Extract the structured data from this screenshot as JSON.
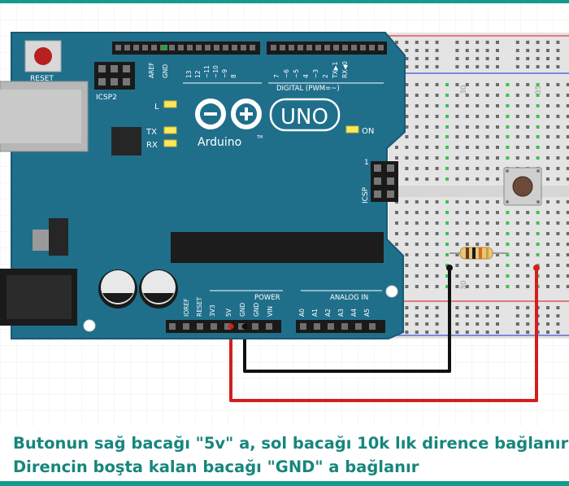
{
  "board": {
    "reset_label": "RESET",
    "icsp2_label": "ICSP2",
    "icsp_label": "ICSP",
    "icsp_pin1": "1",
    "aref": "AREF",
    "gnd": "GND",
    "pins_digital": [
      "13",
      "12",
      "~11",
      "~10",
      "~9",
      "8",
      "7",
      "~6",
      "~5",
      "4",
      "~3",
      "2",
      "TX▶1",
      "RX◀0"
    ],
    "digital_label": "DIGITAL (PWM=~)",
    "led_l": "L",
    "led_tx": "TX",
    "led_rx": "RX",
    "on_label": "ON",
    "brand": "Arduino",
    "tm": "TM",
    "model": "UNO",
    "power_label": "POWER",
    "power_pins": [
      "IOREF",
      "RESET",
      "3V3",
      "5V",
      "GND",
      "GND",
      "VIN"
    ],
    "analog_label": "ANALOG IN",
    "analog_pins": [
      "A0",
      "A1",
      "A2",
      "A3",
      "A4",
      "A5"
    ]
  },
  "breadboard": {
    "col_label_top_30": "30",
    "col_label_top_35": "35",
    "col_label_bottom_30": "30"
  },
  "captions": {
    "line1": "Butonun sağ bacağı \"5v\" a, sol bacağı 10k lık dirence bağlanır",
    "line2": "Direncin boşta kalan bacağı \"GND\" a bağlanır"
  },
  "colors": {
    "board": "#1f6f8b",
    "accent": "#129a8c",
    "wire_5v": "#d21f1f",
    "wire_gnd": "#111111"
  }
}
